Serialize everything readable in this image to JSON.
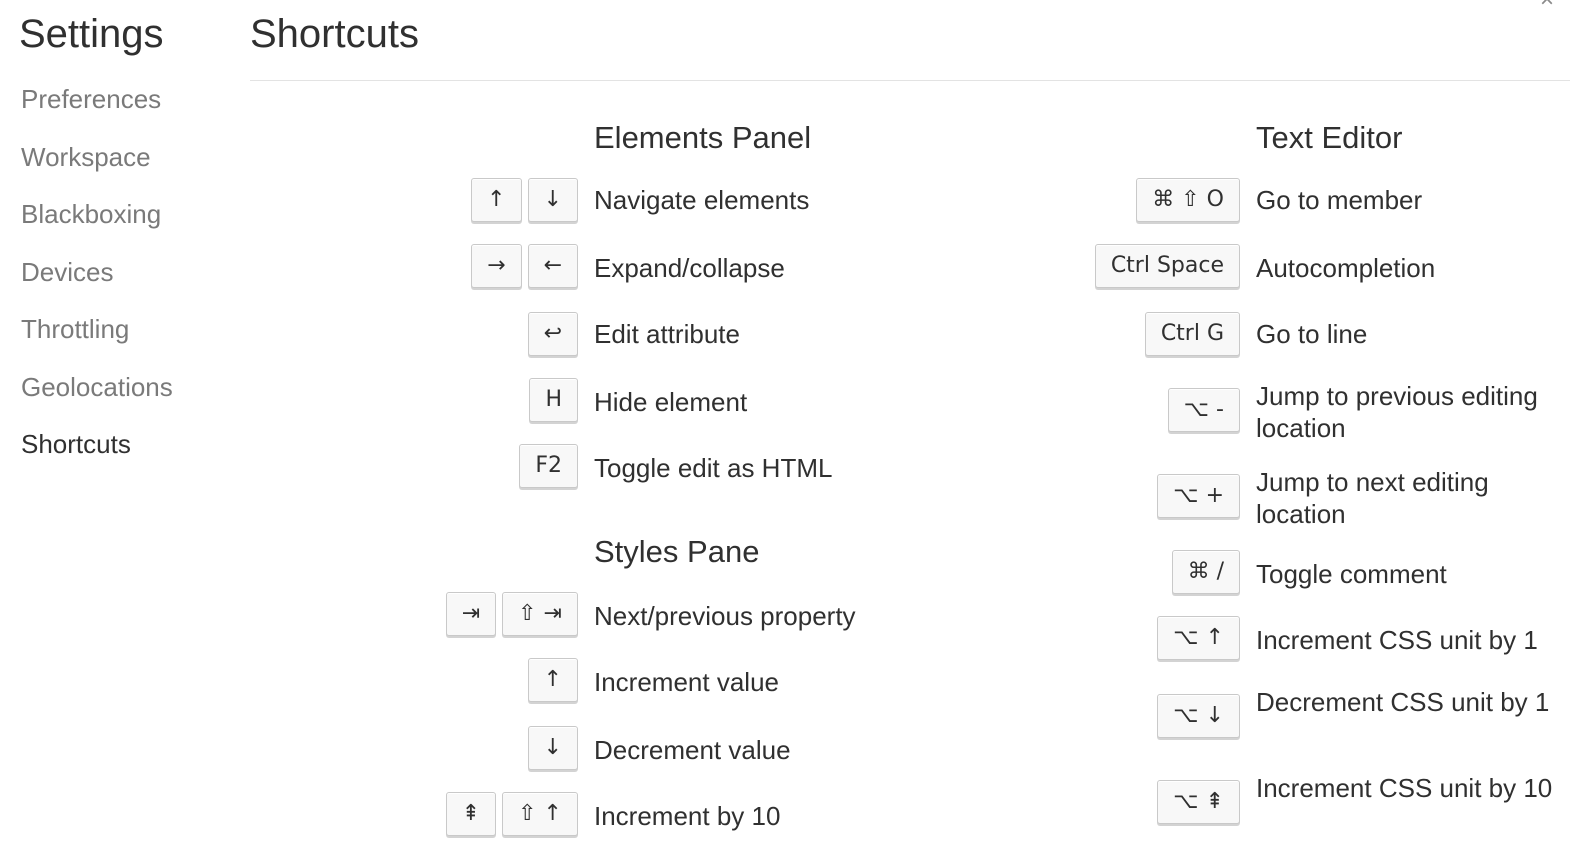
{
  "sidebar": {
    "title": "Settings",
    "items": [
      {
        "label": "Preferences",
        "active": false
      },
      {
        "label": "Workspace",
        "active": false
      },
      {
        "label": "Blackboxing",
        "active": false
      },
      {
        "label": "Devices",
        "active": false
      },
      {
        "label": "Throttling",
        "active": false
      },
      {
        "label": "Geolocations",
        "active": false
      },
      {
        "label": "Shortcuts",
        "active": true
      }
    ]
  },
  "header": {
    "title": "Shortcuts",
    "close_icon": "×"
  },
  "sections": {
    "elements": {
      "title": "Elements Panel",
      "shortcuts": [
        {
          "keys": [
            "↑",
            "↓"
          ],
          "description": "Navigate elements"
        },
        {
          "keys": [
            "→",
            "←"
          ],
          "description": "Expand/collapse"
        },
        {
          "keys": [
            "↩"
          ],
          "description": "Edit attribute"
        },
        {
          "keys": [
            "H"
          ],
          "description": "Hide element"
        },
        {
          "keys": [
            "F2"
          ],
          "description": "Toggle edit as HTML"
        }
      ]
    },
    "styles": {
      "title": "Styles Pane",
      "shortcuts": [
        {
          "keys": [
            "⇥",
            "⇧ ⇥"
          ],
          "description": "Next/previous property"
        },
        {
          "keys": [
            "↑"
          ],
          "description": "Increment value"
        },
        {
          "keys": [
            "↓"
          ],
          "description": "Decrement value"
        },
        {
          "keys": [
            "⇞",
            "⇧ ↑"
          ],
          "description": "Increment by 10"
        }
      ]
    },
    "text_editor": {
      "title": "Text Editor",
      "shortcuts": [
        {
          "keys": [
            "⌘ ⇧ O"
          ],
          "description": "Go to member"
        },
        {
          "keys": [
            "Ctrl Space"
          ],
          "description": "Autocompletion"
        },
        {
          "keys": [
            "Ctrl G"
          ],
          "description": "Go to line"
        },
        {
          "keys": [
            "⌥ -"
          ],
          "description": "Jump to previous editing location"
        },
        {
          "keys": [
            "⌥ +"
          ],
          "description": "Jump to next editing location"
        },
        {
          "keys": [
            "⌘ /"
          ],
          "description": "Toggle comment"
        },
        {
          "keys": [
            "⌥ ↑"
          ],
          "description": "Increment CSS unit by 1"
        },
        {
          "keys": [
            "⌥ ↓"
          ],
          "description": "Decrement CSS unit by 1"
        },
        {
          "keys": [
            "⌥ ⇞"
          ],
          "description": "Increment CSS unit by 10"
        }
      ]
    }
  }
}
